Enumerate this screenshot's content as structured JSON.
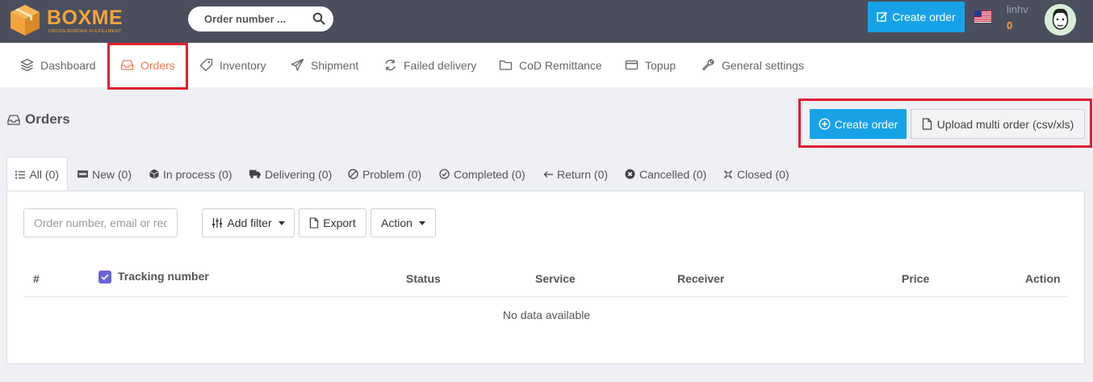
{
  "brand": {
    "name": "BOXME",
    "tagline": "CROSS-BORDER FULFILLMENT"
  },
  "topbar": {
    "search_label": "Order number ...",
    "create_order": "Create order",
    "username": "linhv",
    "balance": "0"
  },
  "nav": {
    "items": [
      {
        "label": "Dashboard",
        "icon": "layers-icon"
      },
      {
        "label": "Orders",
        "icon": "inbox-icon",
        "active": true
      },
      {
        "label": "Inventory",
        "icon": "tag-icon"
      },
      {
        "label": "Shipment",
        "icon": "plane-icon"
      },
      {
        "label": "Failed delivery",
        "icon": "refresh-icon"
      },
      {
        "label": "CoD Remittance",
        "icon": "folder-icon"
      },
      {
        "label": "Topup",
        "icon": "credit-card-icon"
      },
      {
        "label": "General settings",
        "icon": "wrench-icon"
      }
    ]
  },
  "page": {
    "title": "Orders",
    "create_order": "Create order",
    "upload": "Upload multi order (csv/xls)"
  },
  "tabs": [
    {
      "label": "All (0)",
      "icon": "list-icon",
      "active": true
    },
    {
      "label": "New (0)",
      "icon": "new-badge-icon"
    },
    {
      "label": "In process (0)",
      "icon": "cube-icon"
    },
    {
      "label": "Delivering (0)",
      "icon": "truck-icon"
    },
    {
      "label": "Problem (0)",
      "icon": "ban-icon"
    },
    {
      "label": "Completed (0)",
      "icon": "check-circle-icon"
    },
    {
      "label": "Return (0)",
      "icon": "arrow-left-icon"
    },
    {
      "label": "Cancelled (0)",
      "icon": "x-circle-icon"
    },
    {
      "label": "Closed (0)",
      "icon": "x-square-icon"
    }
  ],
  "toolbar": {
    "search_placeholder": "Order number, email or rec",
    "add_filter": "Add filter",
    "export": "Export",
    "action": "Action"
  },
  "table": {
    "columns": [
      "#",
      "Tracking number",
      "Status",
      "Service",
      "Receiver",
      "Price",
      "Action"
    ],
    "empty": "No data available"
  },
  "colors": {
    "topbar": "#4b4f5d",
    "brand": "#f3a33c",
    "primary": "#17a2e8",
    "active_nav": "#f07a50",
    "highlight": "#e0202e",
    "checkbox": "#6c63d8"
  }
}
